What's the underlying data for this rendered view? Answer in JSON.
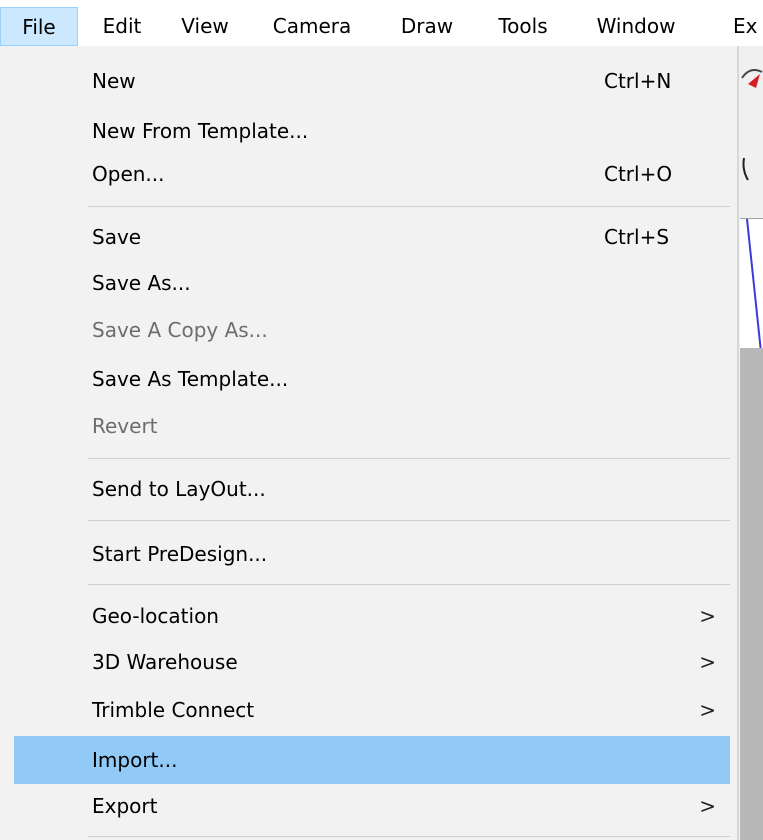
{
  "menubar": {
    "items": [
      {
        "label": "File",
        "active": true
      },
      {
        "label": "Edit"
      },
      {
        "label": "View"
      },
      {
        "label": "Camera"
      },
      {
        "label": "Draw"
      },
      {
        "label": "Tools"
      },
      {
        "label": "Window"
      },
      {
        "label": "Ex"
      }
    ]
  },
  "file_menu": {
    "items": [
      {
        "label": "New",
        "shortcut": "Ctrl+N"
      },
      {
        "label": "New From Template..."
      },
      {
        "label": "Open...",
        "shortcut": "Ctrl+O"
      },
      {
        "label": "Save",
        "shortcut": "Ctrl+S"
      },
      {
        "label": "Save As..."
      },
      {
        "label": "Save A Copy As...",
        "disabled": true
      },
      {
        "label": "Save As Template..."
      },
      {
        "label": "Revert",
        "disabled": true
      },
      {
        "label": "Send to LayOut..."
      },
      {
        "label": "Start PreDesign..."
      },
      {
        "label": "Geo-location",
        "submenu": true
      },
      {
        "label": "3D Warehouse",
        "submenu": true
      },
      {
        "label": "Trimble Connect",
        "submenu": true
      },
      {
        "label": "Import...",
        "highlighted": true
      },
      {
        "label": "Export",
        "submenu": true
      }
    ],
    "submenu_glyph": ">"
  },
  "colors": {
    "menu_background": "#f2f2f2",
    "highlight": "#91c9f7",
    "active_menubar_item": "#cce8ff",
    "disabled_text": "#6d6d6d"
  }
}
